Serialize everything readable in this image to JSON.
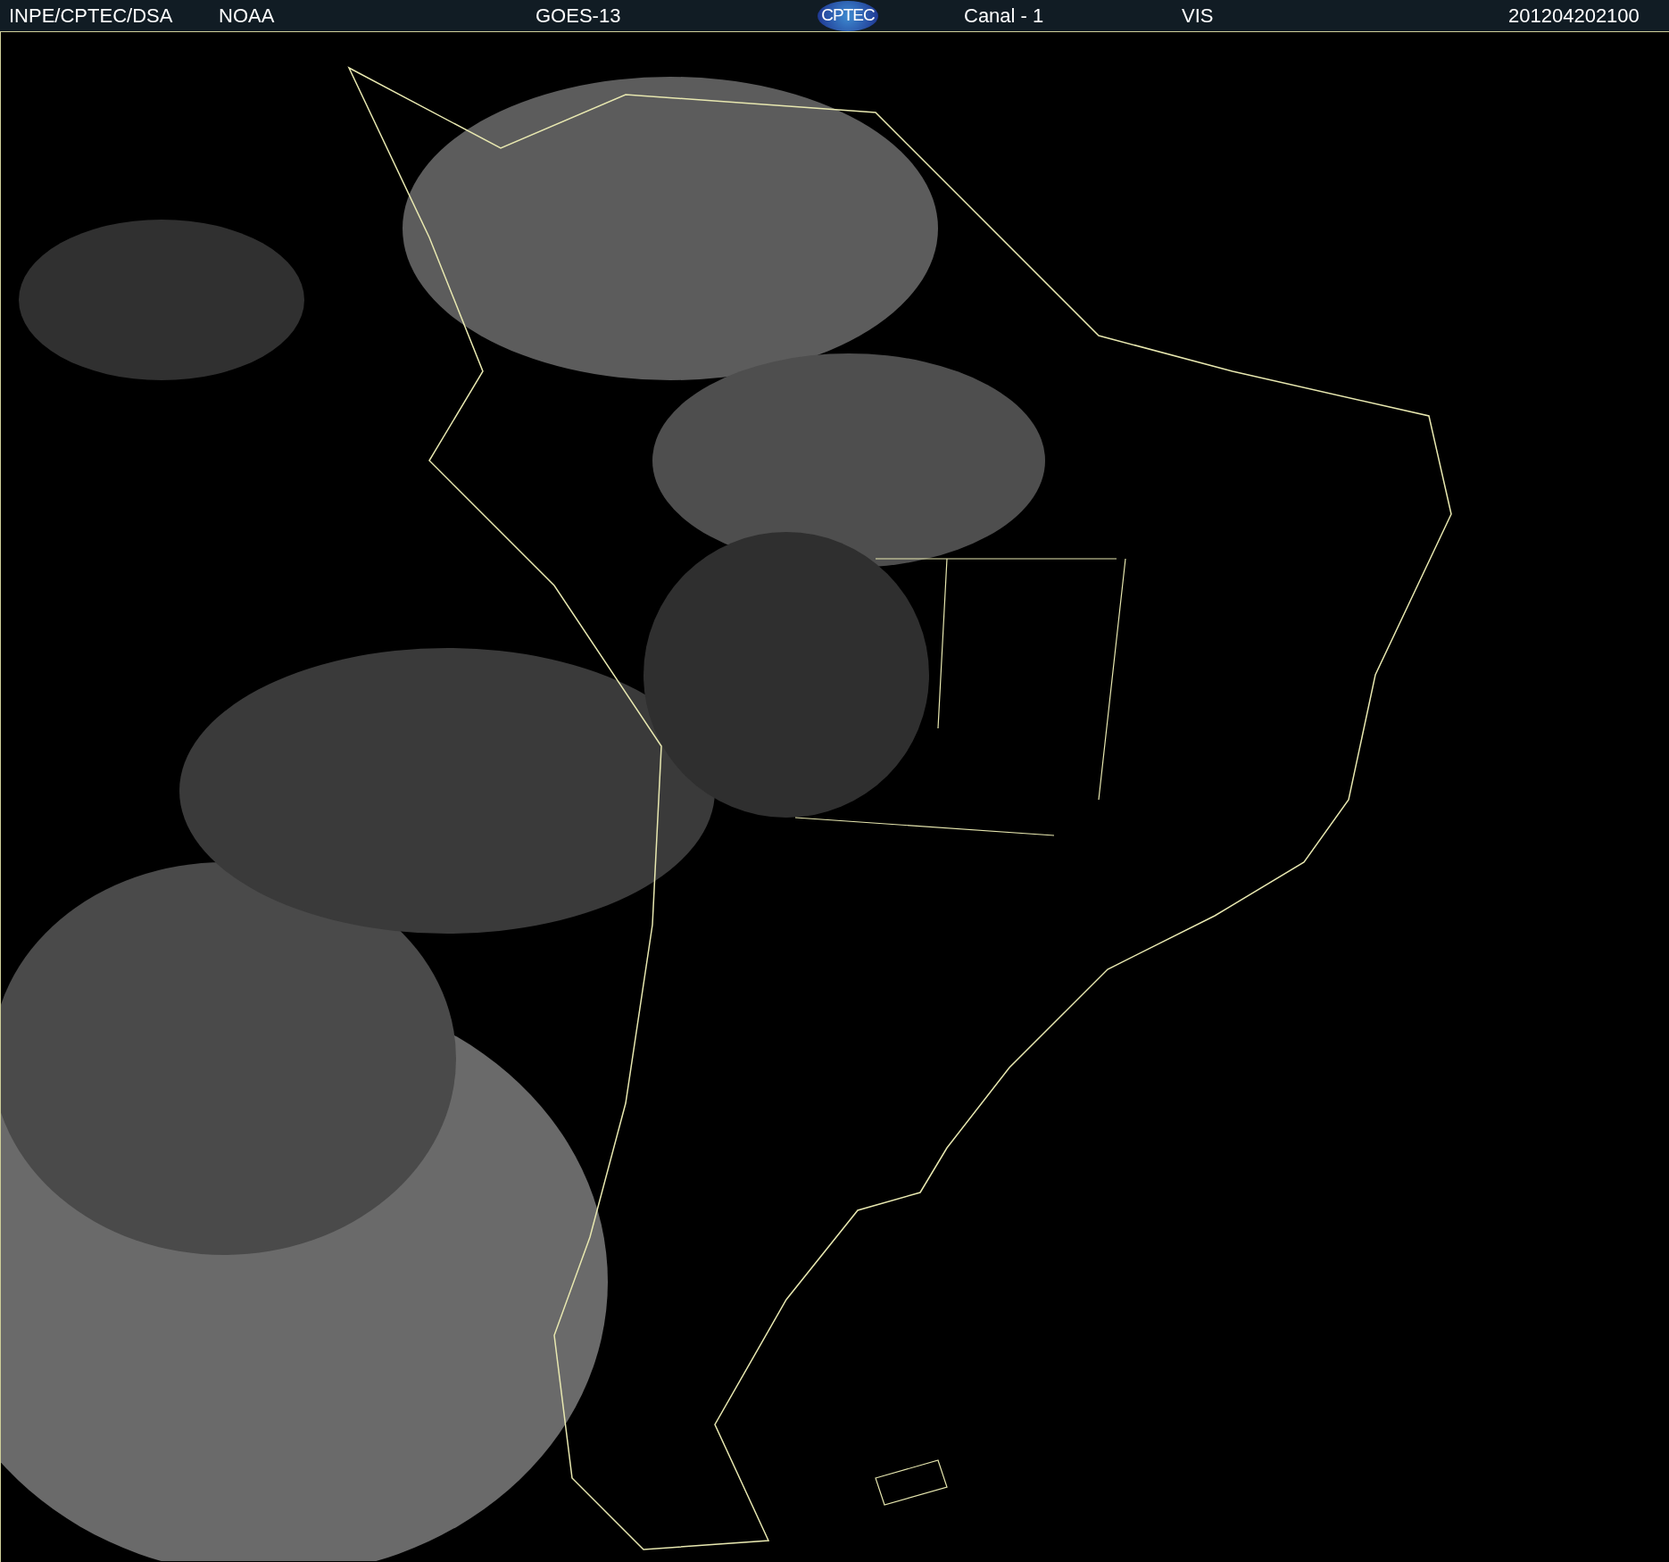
{
  "header": {
    "source": "INPE/CPTEC/DSA",
    "agency": "NOAA",
    "satellite": "GOES-13",
    "logo": "CPTEC",
    "channel": "Canal - 1",
    "band": "VIS",
    "timestamp": "201204202100"
  }
}
